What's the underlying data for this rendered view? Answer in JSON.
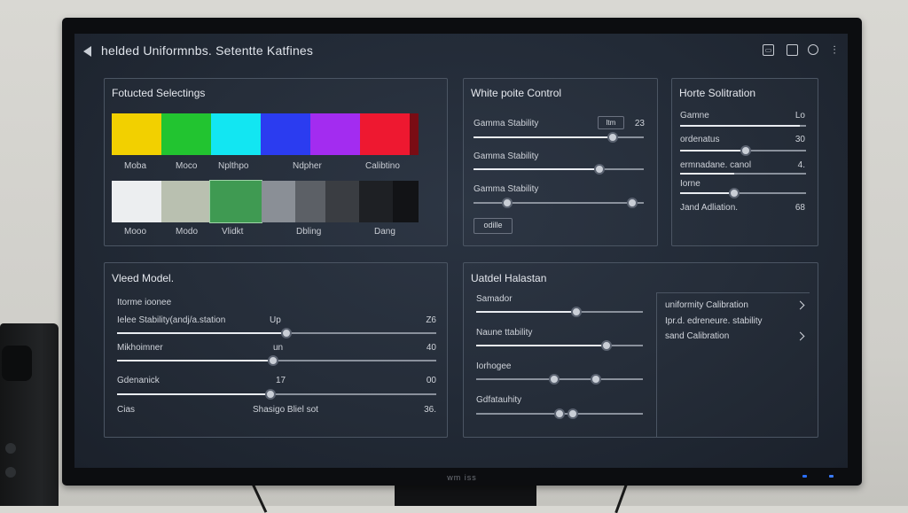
{
  "window": {
    "title": "helded Uniformnbs. Setentte Katfines",
    "icons": [
      "save-icon",
      "window-icon",
      "help-icon",
      "sliders-icon"
    ]
  },
  "bezel": {
    "brand": "wm iss"
  },
  "panels": {
    "selections": {
      "title": "Fotucted Selectings",
      "color_swatches": [
        "#f2d000",
        "#22c430",
        "#12e6f2",
        "#2b3cf0",
        "#a32cf0",
        "#ee1830",
        "#7a0c14"
      ],
      "color_labels": [
        "Moba",
        "Moco",
        "Nplthpo",
        "Ndpher",
        "Calibtino"
      ],
      "gray_swatches": [
        "#eceef0",
        "#b9c0b0",
        "#3f9a52",
        "#8a8f96",
        "#5c6066",
        "#3a3d42",
        "#1e2024",
        "#121316"
      ],
      "gray_labels": [
        "Mooo",
        "Modo",
        "Vlidkt",
        "Dbling",
        "Dang"
      ]
    },
    "white_point": {
      "title": "White poite Control",
      "rows": [
        {
          "label": "Gamma Stability",
          "tag": "ltm",
          "value": "23",
          "level": 0.82
        },
        {
          "label": "Gamma Stability",
          "level": 0.74
        },
        {
          "label": "Gamma Stability",
          "levels": [
            0.2,
            0.93
          ]
        }
      ],
      "button": "odille"
    },
    "horte": {
      "title": "Horte Solitration",
      "rows": [
        {
          "label": "Gamne",
          "value": "Lo",
          "level": 0.95
        },
        {
          "label": "ordenatus",
          "value": "30",
          "level": 0.52
        },
        {
          "label": "ermnadane. canol",
          "value": "4.",
          "level": 0.43
        },
        {
          "label": "Iorne",
          "value": "",
          "level": 0.43
        },
        {
          "label": "Jand Adliation.",
          "value": "68"
        }
      ]
    },
    "model": {
      "title": "Vleed Model.",
      "subtitle": "Itorme ioonee",
      "rows": [
        {
          "label": "Ielee Stability(andj/a.station",
          "mid": "Up",
          "value": "Z6",
          "level": 0.53
        },
        {
          "label": "Mikhoimner",
          "mid": "un",
          "value": "40",
          "level": 0.49
        },
        {
          "label": "Gdenanick",
          "mid": "17",
          "value": "00",
          "level": 0.48
        },
        {
          "label": "Cias",
          "mid": "Shasigo Bliel sot",
          "value": "36."
        }
      ]
    },
    "uniformity": {
      "title": "Uatdel Halastan",
      "sliders": [
        {
          "label": "Samador",
          "levels": [
            0.6
          ]
        },
        {
          "label": "Naune ttability",
          "levels": [
            0.78
          ]
        },
        {
          "label": "Iorhogee",
          "levels": [
            0.47,
            0.72
          ]
        },
        {
          "label": "Gdfatauhity",
          "levels": [
            0.5,
            0.58
          ]
        }
      ],
      "menu": [
        {
          "label": "uniformity Calibration",
          "chevron": true
        },
        {
          "label": "Ipr.d. edreneure. stability",
          "chevron": false
        },
        {
          "label": "sand Calibration",
          "chevron": true
        }
      ]
    }
  }
}
